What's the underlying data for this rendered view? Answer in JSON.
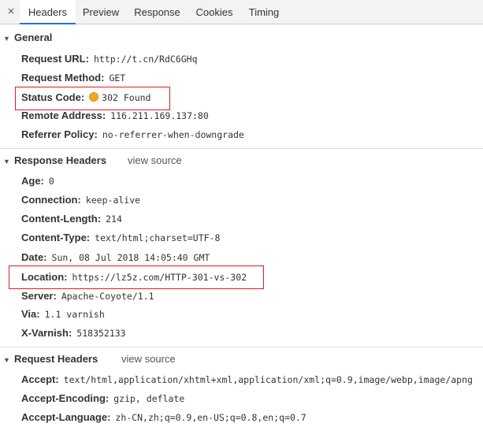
{
  "tabs": {
    "close": "×",
    "items": [
      "Headers",
      "Preview",
      "Response",
      "Cookies",
      "Timing"
    ]
  },
  "general": {
    "title": "General",
    "request_url": {
      "key": "Request URL:",
      "value": "http://t.cn/RdC6GHq"
    },
    "request_method": {
      "key": "Request Method:",
      "value": "GET"
    },
    "status_code": {
      "key": "Status Code:",
      "value": "302 Found",
      "status_color": "#f5a623"
    },
    "remote_address": {
      "key": "Remote Address:",
      "value": "116.211.169.137:80"
    },
    "referrer_policy": {
      "key": "Referrer Policy:",
      "value": "no-referrer-when-downgrade"
    }
  },
  "response_headers": {
    "title": "Response Headers",
    "view_source": "view source",
    "rows": [
      {
        "key": "Age:",
        "value": "0"
      },
      {
        "key": "Connection:",
        "value": "keep-alive"
      },
      {
        "key": "Content-Length:",
        "value": "214"
      },
      {
        "key": "Content-Type:",
        "value": "text/html;charset=UTF-8"
      },
      {
        "key": "Date:",
        "value": "Sun, 08 Jul 2018 14:05:40 GMT"
      },
      {
        "key": "Location:",
        "value": "https://lz5z.com/HTTP-301-vs-302"
      },
      {
        "key": "Server:",
        "value": "Apache-Coyote/1.1"
      },
      {
        "key": "Via:",
        "value": "1.1 varnish"
      },
      {
        "key": "X-Varnish:",
        "value": "518352133"
      }
    ]
  },
  "request_headers": {
    "title": "Request Headers",
    "view_source": "view source",
    "rows": [
      {
        "key": "Accept:",
        "value": "text/html,application/xhtml+xml,application/xml;q=0.9,image/webp,image/apng"
      },
      {
        "key": "Accept-Encoding:",
        "value": "gzip, deflate"
      },
      {
        "key": "Accept-Language:",
        "value": "zh-CN,zh;q=0.9,en-US;q=0.8,en;q=0.7"
      }
    ]
  },
  "colors": {
    "highlight": "#e01b24",
    "tab_active": "#1a73e8"
  }
}
